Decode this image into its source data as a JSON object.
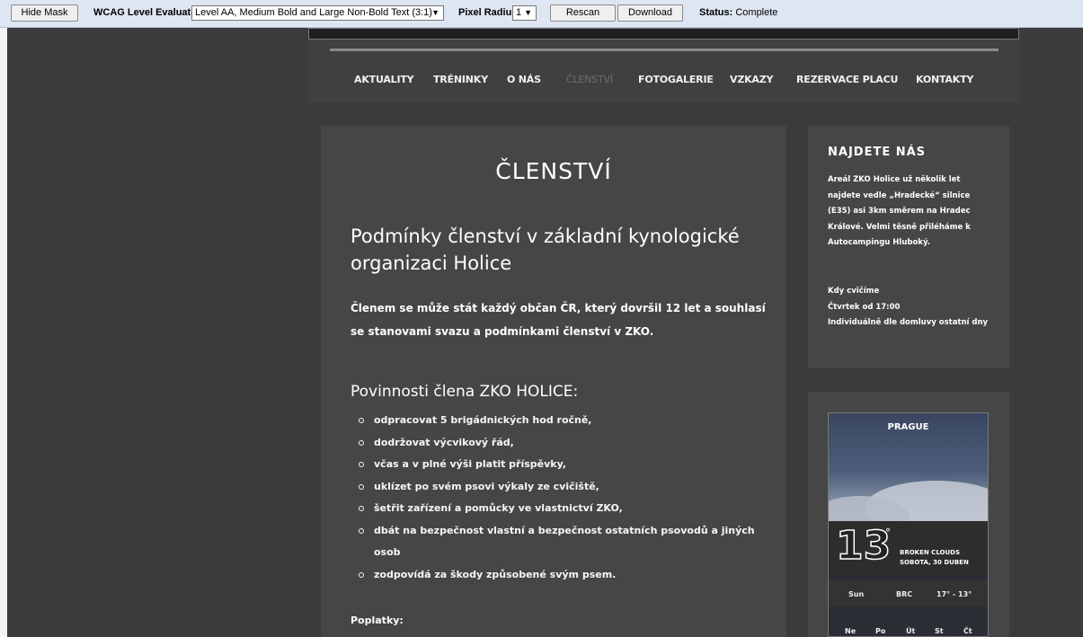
{
  "toolbar": {
    "hide_mask": "Hide Mask",
    "wcag_label": "WCAG Level Evaluated:",
    "wcag_value": "Level AA, Medium Bold and Large Non-Bold Text (3:1)",
    "pixel_label": "Pixel Radius:",
    "pixel_value": "1",
    "rescan": "Rescan",
    "download": "Download",
    "status_label": "Status:",
    "status_value": "Complete"
  },
  "nav": {
    "items": [
      "AKTUALITY",
      "TRÉNINKY",
      "O NÁS",
      "ČLENSTVÍ",
      "FOTOGALERIE",
      "VZKAZY",
      "REZERVACE PLACU",
      "KONTAKTY"
    ],
    "active": "ČLENSTVÍ"
  },
  "main": {
    "title": "ČLENSTVÍ",
    "subtitle": "Podmínky členství v základní kynologické organizaci Holice",
    "intro": "Členem se může stát každý občan ČR, který dovršil 12 let a souhlasí se stanovami svazu a podmínkami členství v ZKO.",
    "duties_title": "Povinnosti člena ZKO HOLICE:",
    "duties": [
      "odpracovat 5 brigádnických hod ročně,",
      "dodržovat výcvikový řád,",
      "včas a v plné výši platit příspěvky,",
      "uklízet po svém psovi výkaly ze cvičiště,",
      "šetřit zařízení a pomůcky ve vlastnictví ZKO,",
      "dbát na bezpečnost vlastní a bezpečnost ostatních psovodů a jiných osob",
      "zodpovídá za škody způsobené svým psem."
    ],
    "fees_label": "Poplatky:"
  },
  "sidebar": {
    "find_title": "NAJDETE NÁS",
    "find_text": "Areál ZKO Holice už několik let najdete vedle „Hradecké“ silnice (E35) asi 3km směrem na Hradec Králové. Velmi těsně přiléháme k Autocampingu Hluboký.",
    "hours_title": "Kdy cvičíme",
    "hours_day": "Čtvrtek od 17:00",
    "hours_note": "Individuálně dle domluvy ostatní dny"
  },
  "weather": {
    "city": "PRAGUE",
    "temp": "13",
    "deg": "°",
    "cond_line1": "BROKEN CLOUDS",
    "cond_line2": "SOBOTA, 30 DUBEN",
    "row1_a": "Sun",
    "row1_b": "BRC",
    "row1_c": "17° - 13°",
    "days": [
      "Ne",
      "Po",
      "Út",
      "St",
      "Čt"
    ]
  }
}
